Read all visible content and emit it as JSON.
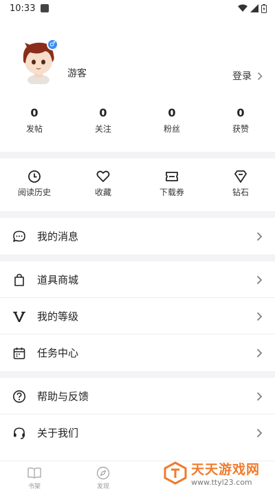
{
  "status_bar": {
    "time": "10:33"
  },
  "profile": {
    "username": "游客",
    "gender_symbol": "♂",
    "login_label": "登录"
  },
  "stats": [
    {
      "value": "0",
      "label": "发帖"
    },
    {
      "value": "0",
      "label": "关注"
    },
    {
      "value": "0",
      "label": "粉丝"
    },
    {
      "value": "0",
      "label": "获赞"
    }
  ],
  "quick_actions": [
    {
      "label": "阅读历史",
      "icon": "clock-icon"
    },
    {
      "label": "收藏",
      "icon": "heart-icon"
    },
    {
      "label": "下载券",
      "icon": "ticket-icon"
    },
    {
      "label": "钻石",
      "icon": "diamond-icon"
    }
  ],
  "menu": {
    "messages": "我的消息",
    "shop": "道具商城",
    "level": "我的等级",
    "tasks": "任务中心",
    "help": "帮助与反馈",
    "about": "关于我们"
  },
  "tabbar": [
    {
      "label": "书架",
      "icon": "book-icon"
    },
    {
      "label": "发现",
      "icon": "compass-icon"
    }
  ],
  "watermark": {
    "title": "天天游戏网",
    "url": "www.ttyl23.com"
  },
  "colors": {
    "accent_blue": "#3a8ef6",
    "watermark_orange": "#f07a2b",
    "section_gap": "#f3f3f5"
  }
}
